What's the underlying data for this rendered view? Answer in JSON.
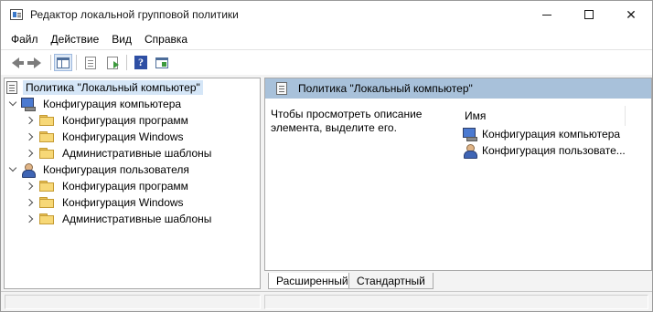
{
  "window": {
    "title": "Редактор локальной групповой политики",
    "minimize_symbol": "",
    "close_symbol": "✕"
  },
  "menu": {
    "items": [
      "Файл",
      "Действие",
      "Вид",
      "Справка"
    ]
  },
  "toolbar": {
    "buttons": [
      "back-arrow-icon",
      "forward-arrow-icon",
      "show-tree-icon",
      "properties-icon",
      "export-list-icon",
      "help-icon",
      "view-icon"
    ],
    "help_glyph": "?"
  },
  "tree": {
    "root": "Политика \"Локальный компьютер\"",
    "computer": {
      "label": "Конфигурация компьютера",
      "children": [
        "Конфигурация программ",
        "Конфигурация Windows",
        "Административные шаблоны"
      ]
    },
    "user": {
      "label": "Конфигурация пользователя",
      "children": [
        "Конфигурация программ",
        "Конфигурация Windows",
        "Административные шаблоны"
      ]
    }
  },
  "details": {
    "header_title": "Политика \"Локальный компьютер\"",
    "description": "Чтобы просмотреть описание элемента, выделите его.",
    "column_name": "Имя",
    "items": [
      "Конфигурация компьютера",
      "Конфигурация пользовате..."
    ]
  },
  "tabs": {
    "extended": "Расширенный",
    "standard": "Стандартный"
  },
  "colors": {
    "header_band": "#a8c1da",
    "selection": "#d5e6f7"
  }
}
